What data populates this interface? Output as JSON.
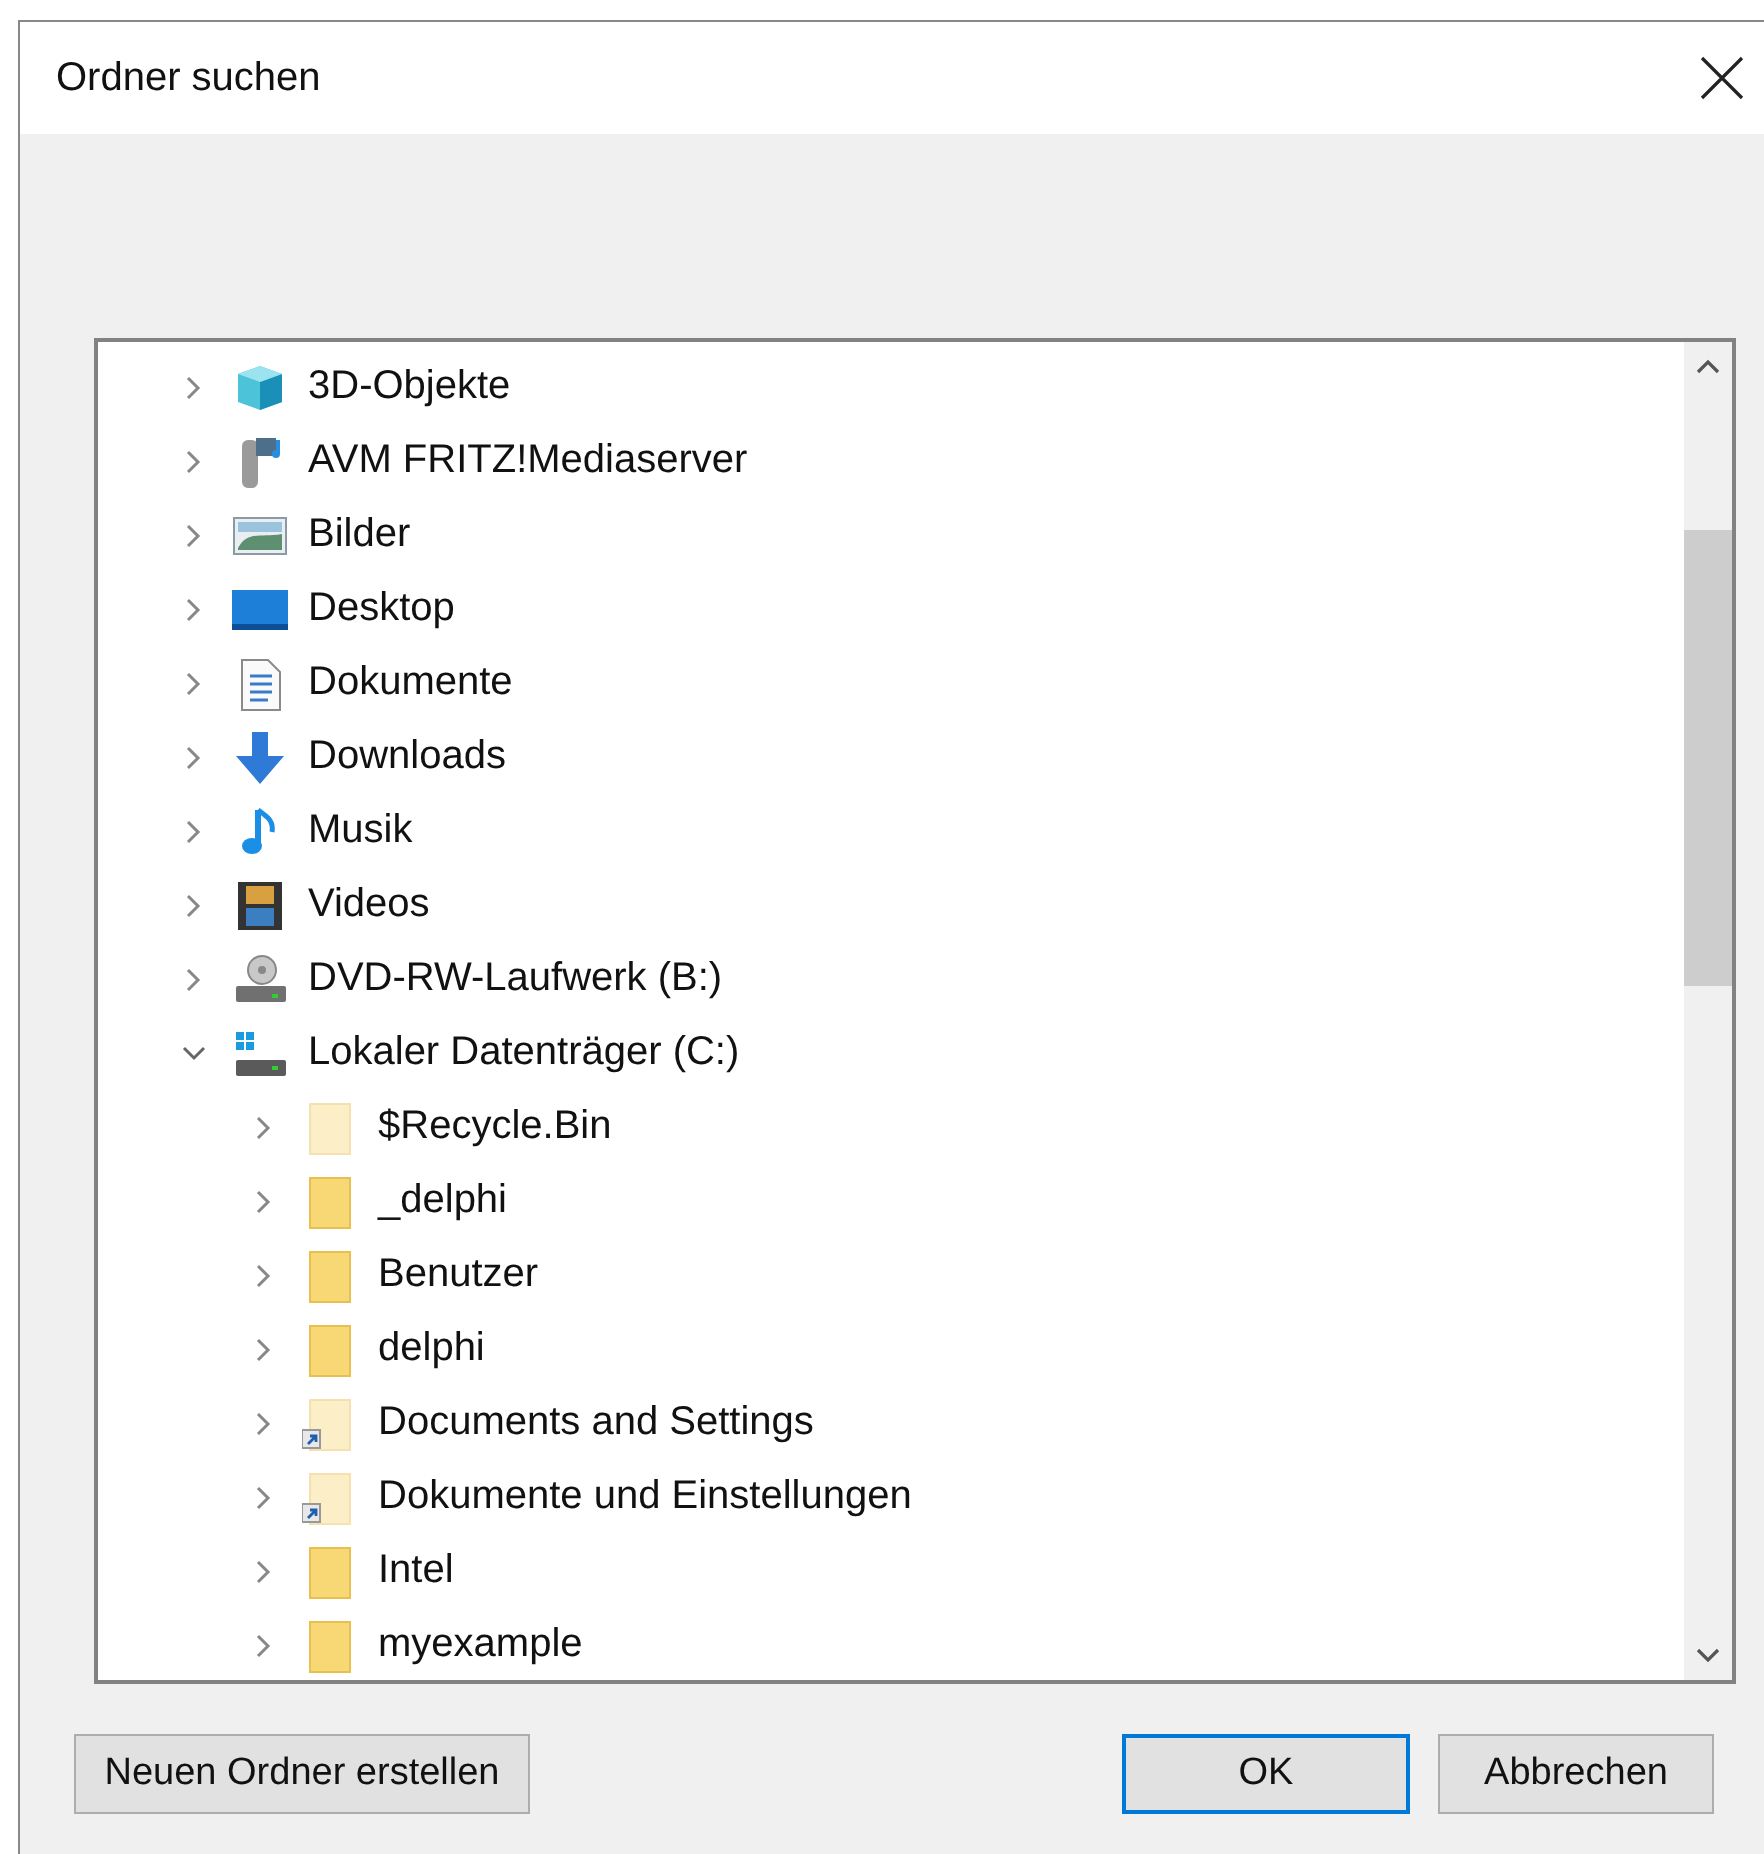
{
  "window": {
    "title": "Ordner suchen"
  },
  "tree": [
    {
      "label": "3D-Objekte",
      "kind": "cube",
      "expanded": false
    },
    {
      "label": "AVM FRITZ!Mediaserver",
      "kind": "media-server",
      "expanded": false
    },
    {
      "label": "Bilder",
      "kind": "pictures",
      "expanded": false
    },
    {
      "label": "Desktop",
      "kind": "desktop",
      "expanded": false
    },
    {
      "label": "Dokumente",
      "kind": "documents",
      "expanded": false
    },
    {
      "label": "Downloads",
      "kind": "downloads",
      "expanded": false
    },
    {
      "label": "Musik",
      "kind": "music",
      "expanded": false
    },
    {
      "label": "Videos",
      "kind": "videos",
      "expanded": false
    },
    {
      "label": "DVD-RW-Laufwerk (B:)",
      "kind": "dvd-drive",
      "expanded": false
    },
    {
      "label": "Lokaler Datenträger (C:)",
      "kind": "local-disk",
      "expanded": true,
      "children": [
        {
          "label": "$Recycle.Bin",
          "kind": "hidden-folder",
          "expanded": false
        },
        {
          "label": "_delphi",
          "kind": "folder",
          "expanded": false
        },
        {
          "label": "Benutzer",
          "kind": "folder",
          "expanded": false
        },
        {
          "label": "delphi",
          "kind": "folder",
          "expanded": false
        },
        {
          "label": "Documents and Settings",
          "kind": "link-folder",
          "expanded": false
        },
        {
          "label": "Dokumente und Einstellungen",
          "kind": "link-folder",
          "expanded": false
        },
        {
          "label": "Intel",
          "kind": "folder",
          "expanded": false
        },
        {
          "label": "myexample",
          "kind": "folder",
          "expanded": false
        }
      ]
    }
  ],
  "buttons": [
    {
      "label": "Neuen Ordner erstellen",
      "kind": "new-folder"
    },
    {
      "label": "OK",
      "kind": "default"
    },
    {
      "label": "Abbrechen",
      "kind": "cancel"
    }
  ]
}
